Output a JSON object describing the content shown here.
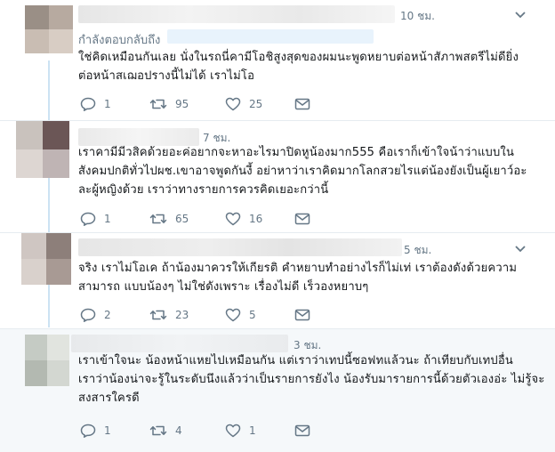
{
  "tweets": [
    {
      "time": "10 ชม.",
      "reply_label": "กำลังตอบกลับถึง",
      "text_lines": [
        "ใช่คิดเหมือนกันเลย นั่งในรถนี่คามีโอชิสูงสุดของผมนะพูดหยาบต่อหน้าสัภาพสตรีไม่ดียิ่ง",
        "ต่อหน้าสเฌอปรางนี้ไม่ได้ เราไม่โอ"
      ],
      "counts": {
        "reply": "1",
        "retweet": "95",
        "like": "25"
      }
    },
    {
      "time": "7 ชม.",
      "text_lines": [
        "เราคามีมีวสิคด้วยอะค่อยากจะหาอะไรมาปิดหูน้องมาก555 คือเราก็เข้าใจน้าว่าแบบใน",
        "สังคมปกติทั่วไปผช.เขาอาจพูดกันงี้ อย่าหาว่าเราคิดมากโลกสวยไรแต่น้องยังเป็นผู้เยาว์อะ",
        "ละผู้หญิงด้วย เราว่าทางรายการควรคิดเยอะกว่านี้"
      ],
      "counts": {
        "reply": "1",
        "retweet": "65",
        "like": "16"
      }
    },
    {
      "time": "5 ชม.",
      "text_lines": [
        "จริง เราไม่โอเค ถ้าน้องมาควรให้เกียรติ คำหยาบทำอย่างไรก็ไม่เท่ เราต้องดังด้วยความ",
        "สามารถ แบบน้องๆ ไม่ใช่ดังเพราะ เรื่องไม่ดี เร็วองหยาบๆ"
      ],
      "counts": {
        "reply": "2",
        "retweet": "23",
        "like": "5"
      }
    },
    {
      "time": "3 ชม.",
      "text_lines": [
        "เราเข้าใจนะ น้องหน้าแหยไปเหมือนกัน แต่เราว่าเทปนี้ซอฟทแล้วนะ ถ้าเทียบกับเทปอื่น",
        "เราว่าน้องน่าจะรู้ในระดับนึงแล้วว่าเป็นรายการยังไง น้องรับมารายการนี้ด้วยตัวเองอ่ะ ไม่รู้จะ",
        "สงสารใครดี"
      ],
      "counts": {
        "reply": "1",
        "retweet": "4",
        "like": "1"
      }
    }
  ],
  "icons": {
    "reply": "reply-icon",
    "retweet": "retweet-icon",
    "like": "heart-icon",
    "dm": "envelope-icon",
    "more": "chevron-down-icon"
  },
  "colors": {
    "icon": "#657786",
    "thread_line": "#cce3f3",
    "highlight_bg": "#f5f8fa",
    "link": "#1da1f2"
  }
}
